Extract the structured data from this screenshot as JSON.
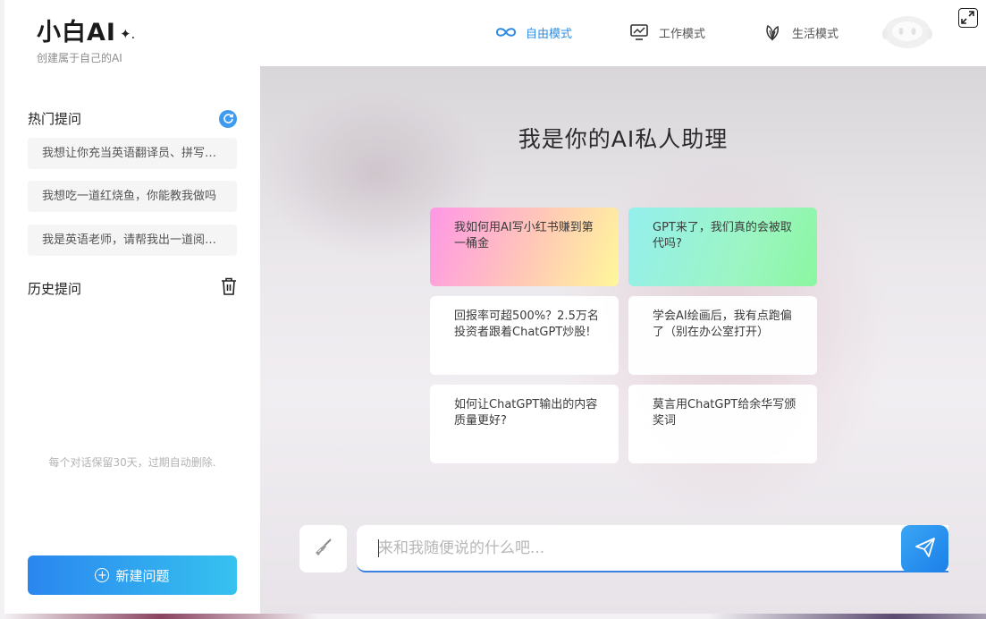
{
  "brand": {
    "title": "小白AI",
    "sparkle": "✦.",
    "subtitle": "创建属于自己的AI"
  },
  "modes": [
    {
      "label": "自由模式",
      "icon": "infinity-icon",
      "active": true
    },
    {
      "label": "工作模式",
      "icon": "monitor-chart-icon",
      "active": false
    },
    {
      "label": "生活模式",
      "icon": "leaf-icon",
      "active": false
    }
  ],
  "sidebar": {
    "hot_title": "热门提问",
    "hot_prompts": [
      "我想让你充当英语翻译员、拼写纠正员和改进员",
      "我想吃一道红烧鱼，你能教我做吗",
      "我是英语老师，请帮我出一道阅读理解题"
    ],
    "history_title": "历史提问",
    "retention_note": "每个对话保留30天，过期自动删除.",
    "new_button": "新建问题"
  },
  "main": {
    "headline": "我是你的AI私人助理",
    "cards": [
      "我如何用AI写小红书赚到第一桶金",
      "GPT来了，我们真的会被取代吗?",
      "回报率可超500%？2.5万名投资者跟着ChatGPT炒股!",
      "学会AI绘画后，我有点跑偏了（别在办公室打开）",
      "如何让ChatGPT输出的内容质量更好?",
      "莫言用ChatGPT给余华写颁奖词"
    ],
    "input_placeholder": "来和我随便说的什么吧..."
  },
  "colors": {
    "accent": "#2f8ce0",
    "send_button": "#1c7fe8",
    "new_button_start": "#2a86ef",
    "new_button_end": "#36c2ef"
  }
}
